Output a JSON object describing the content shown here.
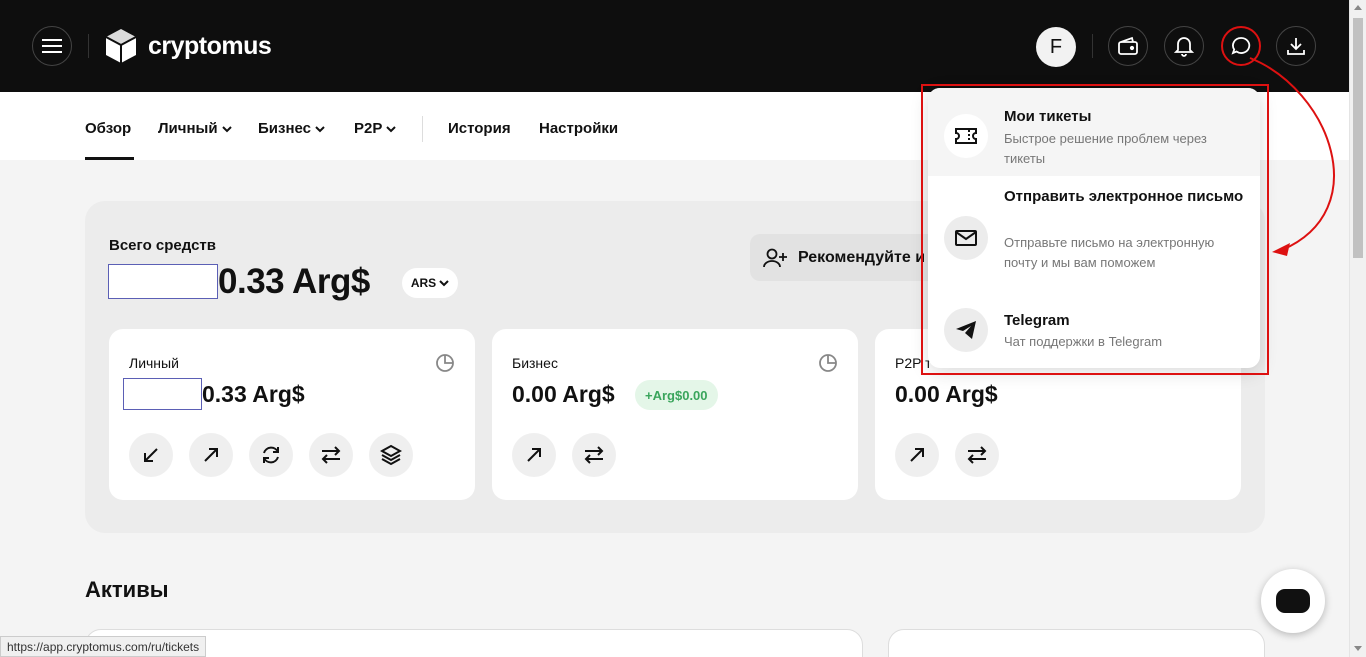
{
  "header": {
    "logo_text": "cryptomus",
    "avatar_letter": "F"
  },
  "nav": {
    "items": [
      {
        "label": "Обзор",
        "active": true,
        "dropdown": false
      },
      {
        "label": "Личный",
        "dropdown": true
      },
      {
        "label": "Бизнес",
        "dropdown": true
      },
      {
        "label": "P2P",
        "dropdown": true
      },
      {
        "label": "История",
        "dropdown": false
      },
      {
        "label": "Настройки",
        "dropdown": false
      }
    ]
  },
  "balance": {
    "label": "Всего средств",
    "amount": "0.33 Arg$",
    "currency": "ARS",
    "recommend_label": "Рекомендуйте и"
  },
  "cards": [
    {
      "title": "Личный",
      "amount": "0.33 Arg$"
    },
    {
      "title": "Бизнес",
      "amount": "0.00 Arg$",
      "delta": "+Arg$0.00"
    },
    {
      "title": "P2P т",
      "amount": "0.00 Arg$"
    }
  ],
  "assets": {
    "title": "Активы"
  },
  "support_menu": {
    "items": [
      {
        "title": "Мои тикеты",
        "subtitle": "Быстрое решение проблем через тикеты",
        "icon": "ticket-icon"
      },
      {
        "title": "Отправить электронное письмо",
        "subtitle": "Отправьте письмо на электронную почту и мы вам поможем",
        "icon": "mail-icon"
      },
      {
        "title": "Telegram",
        "subtitle": "Чат поддержки в Telegram",
        "icon": "telegram-icon"
      }
    ]
  },
  "status_bar": {
    "url": "https://app.cryptomus.com/ru/tickets"
  },
  "colors": {
    "topbar": "#0e0e0e",
    "highlight": "#dd1111",
    "positive": "#3aa55c"
  }
}
